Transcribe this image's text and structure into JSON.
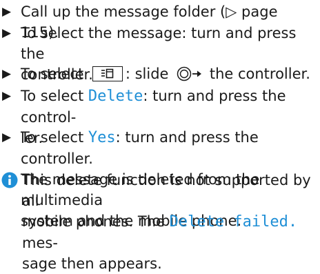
{
  "steps": [
    {
      "line1": "Call up the message folder (▷ page 115)."
    },
    {
      "line1": "To select the message: turn and press the",
      "line2": "controller."
    },
    {
      "prefix": "To select ",
      "icon_name": "message-menu-icon",
      "middle": ": slide ",
      "slide_icon_name": "controller-slide-right-icon",
      "suffix": " the controller."
    },
    {
      "prefix": "To select ",
      "display": "Delete",
      "suffix": ": turn and press the control-",
      "line2": "ler."
    },
    {
      "prefix": "To select ",
      "display": "Yes",
      "suffix": ": turn and press the controller.",
      "line2": "The message is deleted from the multimedia",
      "line3": "system and the mobile phone."
    }
  ],
  "note": {
    "icon_name": "info-icon",
    "line1": "This delete function is not supported by all",
    "line2_prefix": "mobile phones. The ",
    "line2_display": "Delete failed.",
    "line2_suffix": " mes-",
    "line3": "sage then appears."
  },
  "colors": {
    "text": "#1a1a1a",
    "display_text": "#1f8fd6",
    "info_icon": "#1f8fd6"
  }
}
